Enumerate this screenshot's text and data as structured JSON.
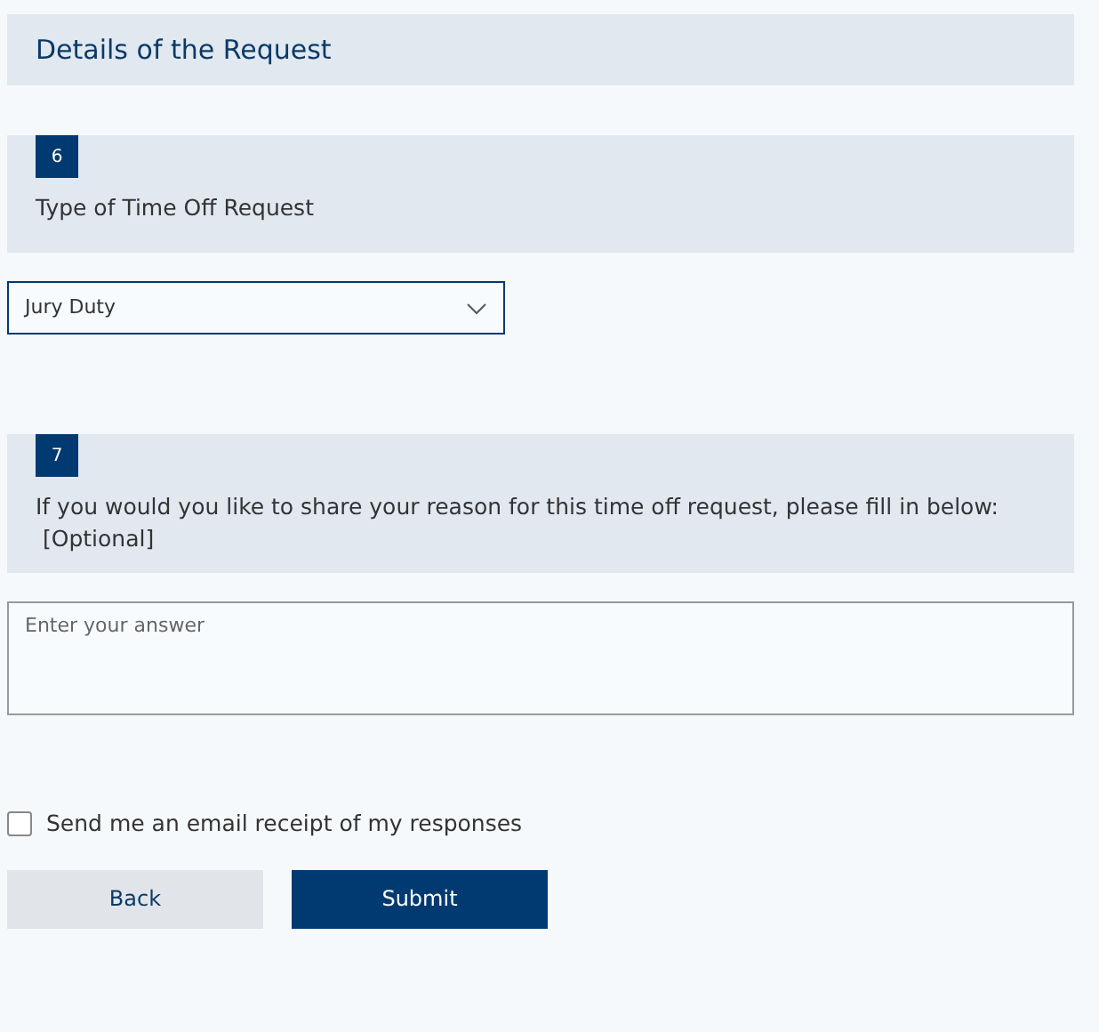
{
  "section_title": "Details of the Request",
  "questions": [
    {
      "kind": "dropdown",
      "number": "6",
      "title": "Type of Time Off Request",
      "value": "Jury Duty"
    },
    {
      "kind": "text",
      "number": "7",
      "title": "If you would you like to share your reason for this time off request, please fill in below:",
      "subtitle": "[Optional]",
      "placeholder": "Enter your answer"
    }
  ],
  "email_receipt": {
    "label": "Send me an email receipt of my responses",
    "checked": false
  },
  "buttons": [
    {
      "kind": "secondary",
      "label": "Back"
    },
    {
      "kind": "primary",
      "label": "Submit"
    }
  ]
}
